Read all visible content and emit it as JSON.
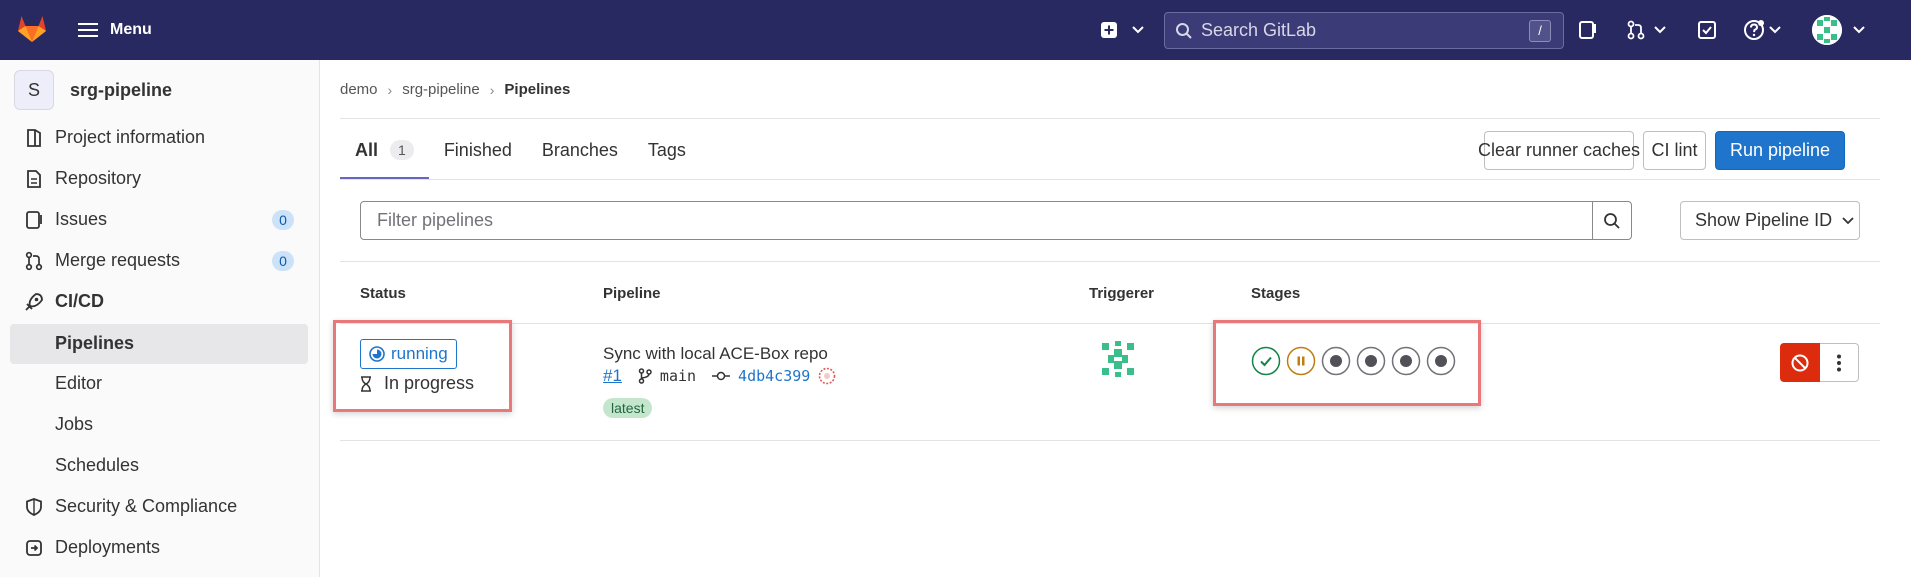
{
  "topbar": {
    "menu_label": "Menu",
    "search_placeholder": "Search GitLab",
    "search_shortcut": "/",
    "icons": [
      "gitlab-logo",
      "hamburger-icon",
      "plus-square-icon",
      "chevron-down-icon",
      "search-icon",
      "issues-icon",
      "merge-request-icon",
      "todo-icon",
      "help-icon",
      "avatar"
    ],
    "background": "#292961"
  },
  "sidebar": {
    "project_initial": "S",
    "project_name": "srg-pipeline",
    "items": [
      {
        "label": "Project information",
        "icon": "project-icon"
      },
      {
        "label": "Repository",
        "icon": "doc-icon"
      },
      {
        "label": "Issues",
        "icon": "issues-icon",
        "count": "0"
      },
      {
        "label": "Merge requests",
        "icon": "merge-request-icon",
        "count": "0"
      },
      {
        "label": "CI/CD",
        "icon": "rocket-icon"
      },
      {
        "label": "Pipelines"
      },
      {
        "label": "Editor"
      },
      {
        "label": "Jobs"
      },
      {
        "label": "Schedules"
      },
      {
        "label": "Security & Compliance",
        "icon": "shield-icon"
      },
      {
        "label": "Deployments",
        "icon": "deployments-icon"
      }
    ]
  },
  "breadcrumb": [
    "demo",
    "srg-pipeline",
    "Pipelines"
  ],
  "tabs": [
    {
      "label": "All",
      "count": "1"
    },
    {
      "label": "Finished"
    },
    {
      "label": "Branches"
    },
    {
      "label": "Tags"
    }
  ],
  "actions": {
    "clear_cache": "Clear runner caches",
    "ci_lint": "CI lint",
    "run_pipeline": "Run pipeline"
  },
  "filter": {
    "placeholder": "Filter pipelines",
    "dropdown": "Show Pipeline ID"
  },
  "table": {
    "headers": [
      "Status",
      "Pipeline",
      "Triggerer",
      "Stages"
    ],
    "rows": [
      {
        "status": "running",
        "duration": "In progress",
        "title": "Sync with local ACE-Box repo",
        "id": "#1",
        "branch": "main",
        "commit": "4db4c399",
        "tag": "latest",
        "stages": [
          "success",
          "manual",
          "created",
          "created",
          "created",
          "created"
        ]
      }
    ]
  },
  "colors": {
    "primary": "#1f75cb",
    "danger": "#dd2b0e",
    "success": "#108548",
    "warning": "#c17d10",
    "highlight": "#e8787a"
  }
}
